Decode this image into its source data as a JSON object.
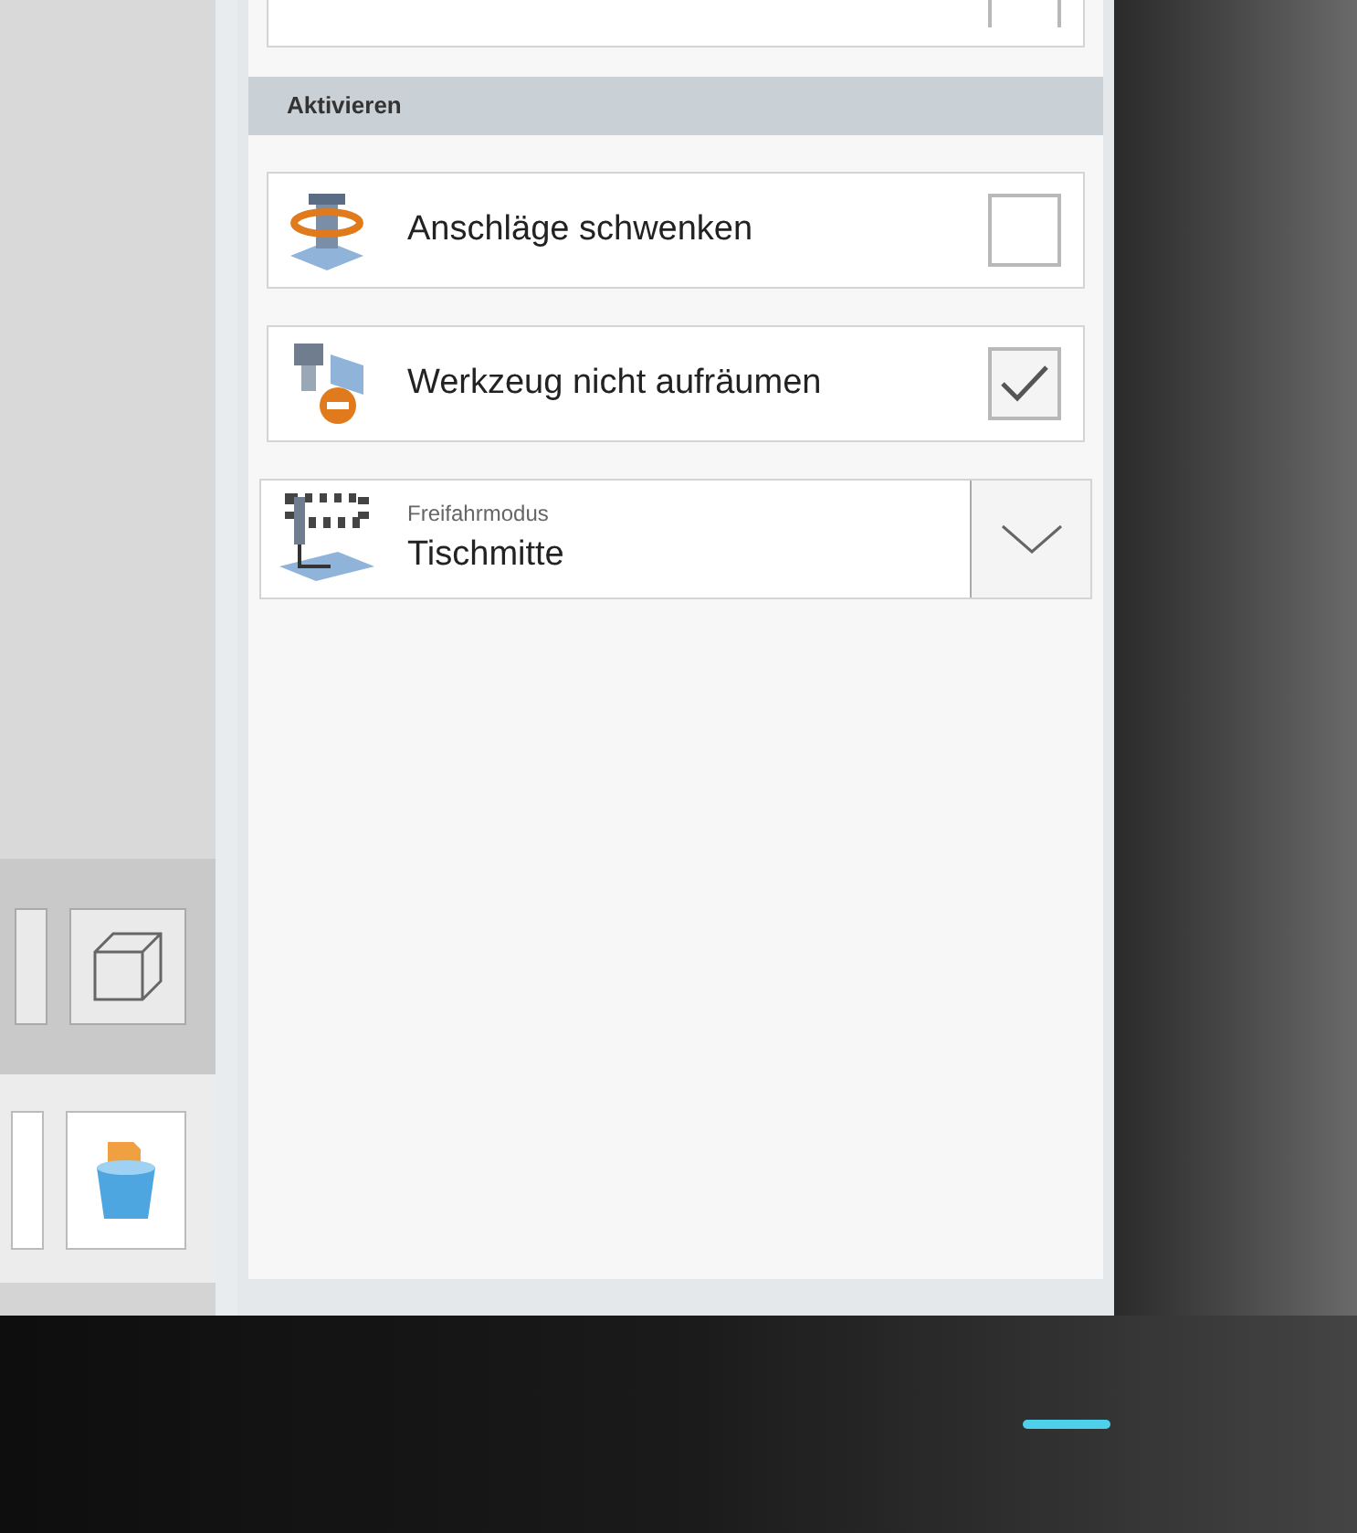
{
  "top_row": {
    "checked": false
  },
  "section": {
    "title": "Aktivieren"
  },
  "options": [
    {
      "kind": "checkbox",
      "label": "Anschläge schwenken",
      "checked": false
    },
    {
      "kind": "checkbox",
      "label": "Werkzeug nicht aufräumen",
      "checked": true
    }
  ],
  "dropdown": {
    "label": "Freifahrmodus",
    "value": "Tischmitte"
  }
}
